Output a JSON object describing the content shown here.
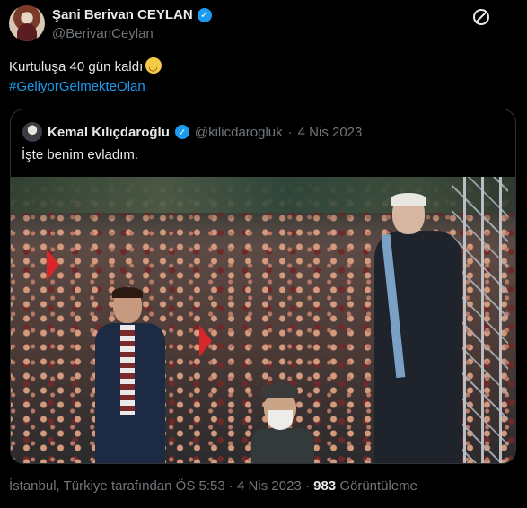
{
  "tweet": {
    "author_name": "Şani Berivan CEYLAN",
    "author_handle": "@BerivanCeylan",
    "text_line1": "Kurtuluşa 40 gün kaldı",
    "emoji_name": "pleading-face",
    "hashtag": "#GeliyorGelmekteOlan"
  },
  "quoted": {
    "author_name": "Kemal Kılıçdaroğlu",
    "author_handle": "@kilicdarogluk",
    "separator": "·",
    "date": "4 Nis 2023",
    "text": "İşte benim evladım.",
    "image_alt": "photo"
  },
  "meta": {
    "location_time": "İstanbul, Türkiye tarafından ÖS 5:53",
    "separator1": "·",
    "date": "4 Nis 2023",
    "separator2": "·",
    "views_count": "983",
    "views_label": "Görüntüleme"
  },
  "colors": {
    "accent": "#1d9bf0",
    "background": "#000000",
    "muted": "#71767b",
    "text": "#e7e9ea"
  }
}
